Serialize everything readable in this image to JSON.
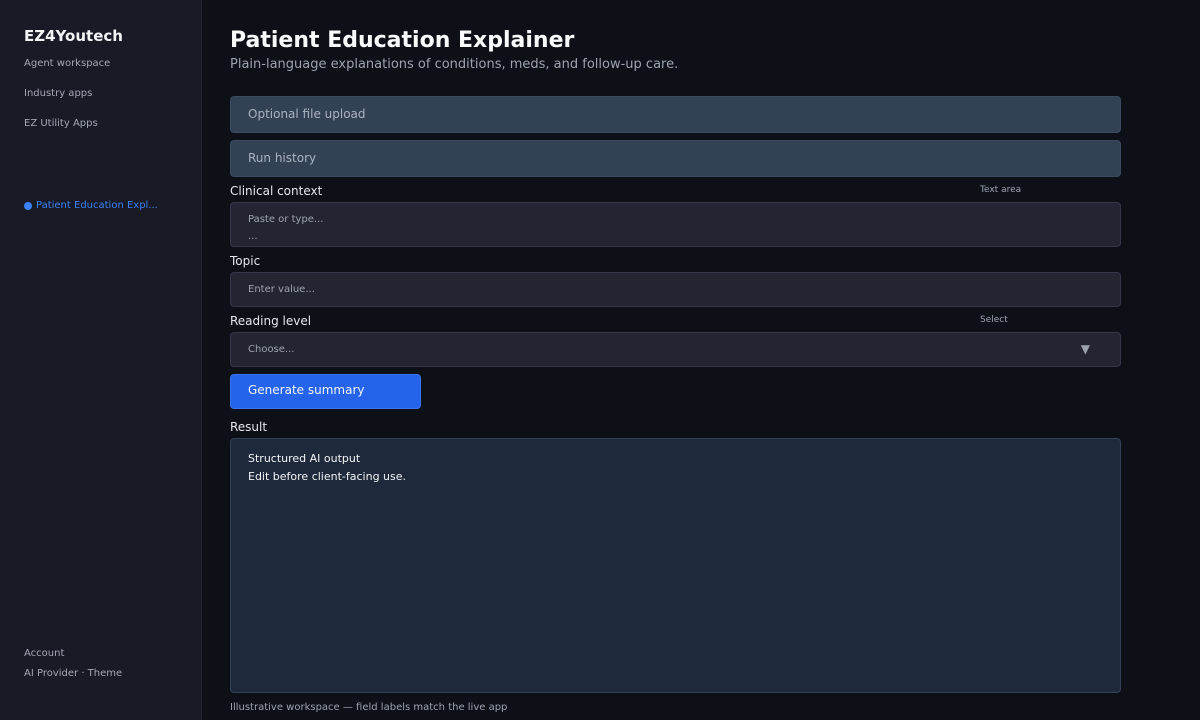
{
  "sidebar": {
    "brand": "EZ4Youtech",
    "nav": [
      {
        "label": "Agent workspace"
      },
      {
        "label": "Industry apps"
      },
      {
        "label": "EZ Utility Apps"
      }
    ],
    "active_item": "Patient Education Expl...",
    "footer": [
      {
        "label": "Account"
      },
      {
        "label": "AI Provider · Theme"
      }
    ]
  },
  "header": {
    "title": "Patient Education Explainer",
    "subtitle": "Plain-language explanations of conditions, meds, and follow-up care."
  },
  "sections": {
    "upload": "Optional file upload",
    "history": "Run history"
  },
  "fields": {
    "clinical_context": {
      "label": "Clinical context",
      "type": "Text area",
      "placeholder_line1": "Paste or type...",
      "placeholder_line2": "..."
    },
    "topic": {
      "label": "Topic",
      "placeholder": "Enter value..."
    },
    "reading_level": {
      "label": "Reading level",
      "type": "Select",
      "placeholder": "Choose...",
      "chevron": "▼"
    }
  },
  "actions": {
    "generate": "Generate summary"
  },
  "result": {
    "label": "Result",
    "line1": "Structured AI output",
    "line2": "Edit before client-facing use."
  },
  "footer_note": "Illustrative workspace — field labels match the live app",
  "colors": {
    "accent": "#2563eb",
    "sidebar_bg": "#181b26",
    "page_bg": "#0d1017",
    "collapsible_bg": "#334155",
    "result_bg": "#1e293b"
  }
}
